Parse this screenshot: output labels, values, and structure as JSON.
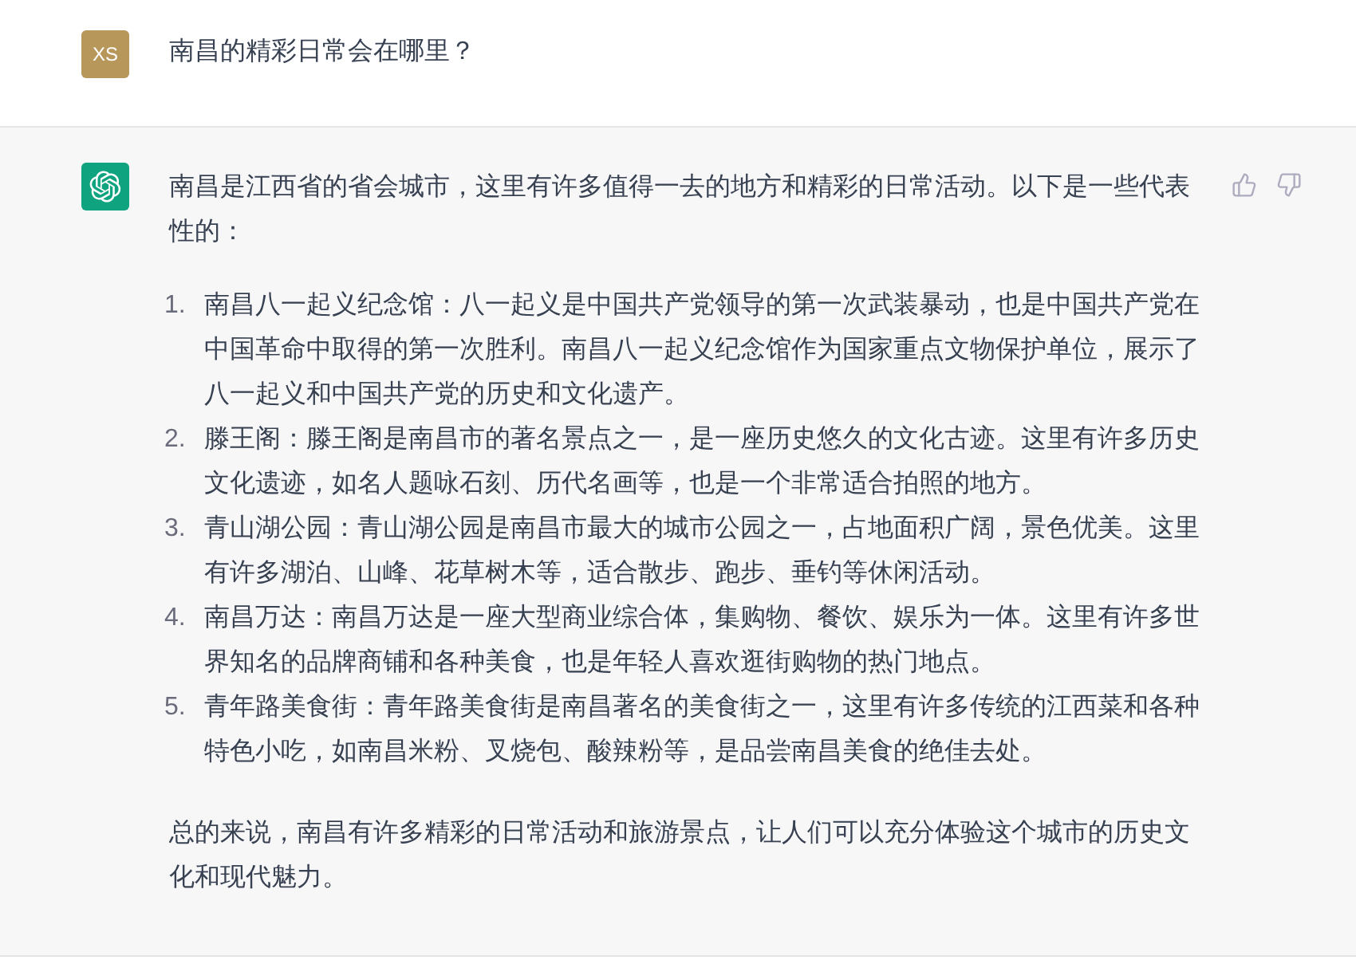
{
  "user_message": {
    "avatar": "XS",
    "text": "南昌的精彩日常会在哪里？"
  },
  "assistant_message": {
    "intro": "南昌是江西省的省会城市，这里有许多值得一去的地方和精彩的日常活动。以下是一些代表性的：",
    "list": [
      {
        "number": "1.",
        "text": "南昌八一起义纪念馆：八一起义是中国共产党领导的第一次武装暴动，也是中国共产党在中国革命中取得的第一次胜利。南昌八一起义纪念馆作为国家重点文物保护单位，展示了八一起义和中国共产党的历史和文化遗产。"
      },
      {
        "number": "2.",
        "text": "滕王阁：滕王阁是南昌市的著名景点之一，是一座历史悠久的文化古迹。这里有许多历史文化遗迹，如名人题咏石刻、历代名画等，也是一个非常适合拍照的地方。"
      },
      {
        "number": "3.",
        "text": "青山湖公园：青山湖公园是南昌市最大的城市公园之一，占地面积广阔，景色优美。这里有许多湖泊、山峰、花草树木等，适合散步、跑步、垂钓等休闲活动。"
      },
      {
        "number": "4.",
        "text": "南昌万达：南昌万达是一座大型商业综合体，集购物、餐饮、娱乐为一体。这里有许多世界知名的品牌商铺和各种美食，也是年轻人喜欢逛街购物的热门地点。"
      },
      {
        "number": "5.",
        "text": "青年路美食街：青年路美食街是南昌著名的美食街之一，这里有许多传统的江西菜和各种特色小吃，如南昌米粉、叉烧包、酸辣粉等，是品尝南昌美食的绝佳去处。"
      }
    ],
    "conclusion": "总的来说，南昌有许多精彩的日常活动和旅游景点，让人们可以充分体验这个城市的历史文化和现代魅力。"
  }
}
